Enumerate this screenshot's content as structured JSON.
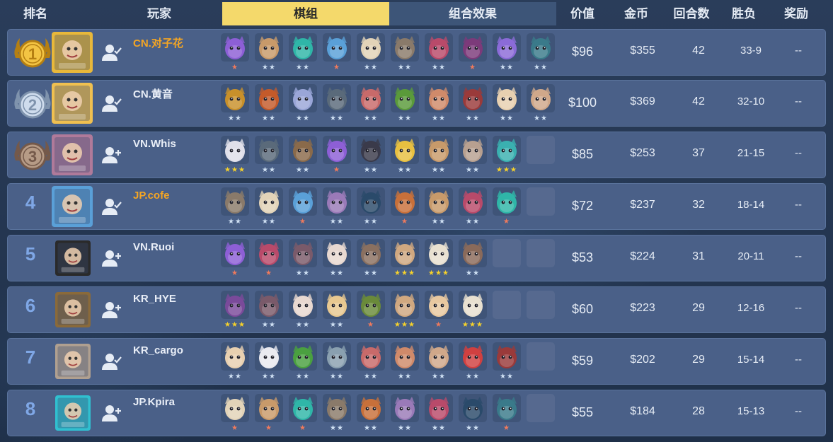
{
  "header": {
    "rank": "排名",
    "player": "玩家",
    "tab_pieces": "棋组",
    "tab_combo": "组合效果",
    "value": "价值",
    "gold": "金币",
    "rounds": "回合数",
    "winloss": "胜负",
    "reward": "奖励"
  },
  "colors": {
    "row_bg": "#4a6088",
    "tab_active": "#f4d96b",
    "highlight_name": "#f5a623",
    "star_bronze": "#f07a5c",
    "star_silver": "#cfe0f3",
    "star_gold": "#f7d22a"
  },
  "rows": [
    {
      "rank": "1",
      "medal": "gold",
      "name": "CN.对子花",
      "highlight": true,
      "friend_icon": "friend-added-icon",
      "value": "$96",
      "gold": "$355",
      "rounds": "42",
      "wl": "33-9",
      "reward": "--",
      "pieces": [
        {
          "c": "#8d5fd6",
          "s": "★"
        },
        {
          "c": "#c89a6a",
          "s": "★★"
        },
        {
          "c": "#2fb6a8",
          "s": "★★"
        },
        {
          "c": "#5aa0d8",
          "s": "★"
        },
        {
          "c": "#e2d3b8",
          "s": "★★"
        },
        {
          "c": "#8a7a6a",
          "s": "★★"
        },
        {
          "c": "#b94a6a",
          "s": "★★"
        },
        {
          "c": "#7c3a7a",
          "s": "★"
        },
        {
          "c": "#8b6bd8",
          "s": "★★"
        },
        {
          "c": "#3a7a8a",
          "s": "★★"
        }
      ]
    },
    {
      "rank": "2",
      "medal": "silver",
      "name": "CN.黄音",
      "highlight": false,
      "friend_icon": "friend-added-icon",
      "value": "$100",
      "gold": "$369",
      "rounds": "42",
      "wl": "32-10",
      "reward": "--",
      "pieces": [
        {
          "c": "#c8902a",
          "s": "★★"
        },
        {
          "c": "#c45a2a",
          "s": "★★"
        },
        {
          "c": "#9aa6d8",
          "s": "★★"
        },
        {
          "c": "#5a6a7a",
          "s": "★★"
        },
        {
          "c": "#c86a6a",
          "s": "★★"
        },
        {
          "c": "#5a9a3a",
          "s": "★★"
        },
        {
          "c": "#d08a6a",
          "s": "★★"
        },
        {
          "c": "#9a3a3a",
          "s": "★★"
        },
        {
          "c": "#e8d0b0",
          "s": "★★"
        },
        {
          "c": "#d0a88a",
          "s": "★★"
        }
      ]
    },
    {
      "rank": "3",
      "medal": "bronze",
      "name": "VN.Whis",
      "highlight": false,
      "friend_icon": "friend-add-icon",
      "value": "$85",
      "gold": "$253",
      "rounds": "37",
      "wl": "21-15",
      "reward": "--",
      "pieces": [
        {
          "c": "#e0e0ea",
          "s": "★★★"
        },
        {
          "c": "#5a6a7a",
          "s": "★★"
        },
        {
          "c": "#8a6a4a",
          "s": "★★"
        },
        {
          "c": "#8d5fd6",
          "s": "★"
        },
        {
          "c": "#3a3a4a",
          "s": "★★"
        },
        {
          "c": "#e8c040",
          "s": "★★"
        },
        {
          "c": "#c89a6a",
          "s": "★★"
        },
        {
          "c": "#b8a090",
          "s": "★★"
        },
        {
          "c": "#3ab0b0",
          "s": "★★★"
        },
        {
          "c": "",
          "s": ""
        }
      ]
    },
    {
      "rank": "4",
      "medal": "",
      "name": "JP.cofe",
      "highlight": true,
      "friend_icon": "friend-added-icon",
      "value": "$72",
      "gold": "$237",
      "rounds": "32",
      "wl": "18-14",
      "reward": "--",
      "pieces": [
        {
          "c": "#8a7a6a",
          "s": "★★"
        },
        {
          "c": "#e2d3b8",
          "s": "★★"
        },
        {
          "c": "#5aa0d8",
          "s": "★"
        },
        {
          "c": "#9a7ab8",
          "s": "★★"
        },
        {
          "c": "#2a4a6a",
          "s": "★★"
        },
        {
          "c": "#c8703a",
          "s": "★"
        },
        {
          "c": "#c89a6a",
          "s": "★★"
        },
        {
          "c": "#b94a6a",
          "s": "★★"
        },
        {
          "c": "#2fb6a8",
          "s": "★"
        },
        {
          "c": "",
          "s": ""
        }
      ]
    },
    {
      "rank": "5",
      "medal": "",
      "name": "VN.Ruoi",
      "highlight": false,
      "friend_icon": "friend-add-icon",
      "value": "$53",
      "gold": "$224",
      "rounds": "31",
      "wl": "20-11",
      "reward": "--",
      "pieces": [
        {
          "c": "#8d5fd6",
          "s": "★"
        },
        {
          "c": "#b94a6a",
          "s": "★"
        },
        {
          "c": "#7a5a6a",
          "s": "★★"
        },
        {
          "c": "#e8d8d0",
          "s": "★★"
        },
        {
          "c": "#8a7060",
          "s": "★★"
        },
        {
          "c": "#d0a880",
          "s": "★★★"
        },
        {
          "c": "#e8e0d0",
          "s": "★★★"
        },
        {
          "c": "#8a6a5a",
          "s": "★★"
        },
        {
          "c": "",
          "s": ""
        },
        {
          "c": "",
          "s": ""
        }
      ]
    },
    {
      "rank": "6",
      "medal": "",
      "name": "KR_HYE",
      "highlight": false,
      "friend_icon": "friend-add-icon",
      "value": "$60",
      "gold": "$223",
      "rounds": "29",
      "wl": "12-16",
      "reward": "--",
      "pieces": [
        {
          "c": "#7a4a9a",
          "s": "★★★"
        },
        {
          "c": "#7a5a6a",
          "s": "★★"
        },
        {
          "c": "#e8d8d0",
          "s": "★★"
        },
        {
          "c": "#e8c890",
          "s": "★★"
        },
        {
          "c": "#6a8a3a",
          "s": "★"
        },
        {
          "c": "#d0a880",
          "s": "★★★"
        },
        {
          "c": "#e8c8a0",
          "s": "★"
        },
        {
          "c": "#e8e0d0",
          "s": "★★★"
        },
        {
          "c": "",
          "s": ""
        },
        {
          "c": "",
          "s": ""
        }
      ]
    },
    {
      "rank": "7",
      "medal": "",
      "name": "KR_cargo",
      "highlight": false,
      "friend_icon": "friend-added-icon",
      "value": "$59",
      "gold": "$202",
      "rounds": "29",
      "wl": "15-14",
      "reward": "--",
      "pieces": [
        {
          "c": "#e8d0b0",
          "s": "★★"
        },
        {
          "c": "#eaeaf0",
          "s": "★★"
        },
        {
          "c": "#4aa040",
          "s": "★★"
        },
        {
          "c": "#8aa0b0",
          "s": "★★"
        },
        {
          "c": "#c86a6a",
          "s": "★★"
        },
        {
          "c": "#d08a6a",
          "s": "★★"
        },
        {
          "c": "#d0a88a",
          "s": "★★"
        },
        {
          "c": "#d04040",
          "s": "★★"
        },
        {
          "c": "#9a3a3a",
          "s": "★★"
        },
        {
          "c": "",
          "s": ""
        }
      ]
    },
    {
      "rank": "8",
      "medal": "",
      "name": "JP.Kpira",
      "highlight": false,
      "friend_icon": "friend-add-icon",
      "value": "$55",
      "gold": "$184",
      "rounds": "28",
      "wl": "15-13",
      "reward": "--",
      "pieces": [
        {
          "c": "#e2d3b8",
          "s": "★"
        },
        {
          "c": "#c89a6a",
          "s": "★"
        },
        {
          "c": "#2fb6a8",
          "s": "★"
        },
        {
          "c": "#8a7a6a",
          "s": "★★"
        },
        {
          "c": "#c8703a",
          "s": "★★"
        },
        {
          "c": "#9a7ab8",
          "s": "★★"
        },
        {
          "c": "#b94a6a",
          "s": "★★"
        },
        {
          "c": "#2a4a6a",
          "s": "★★"
        },
        {
          "c": "#3a7a8a",
          "s": "★"
        },
        {
          "c": "",
          "s": ""
        }
      ]
    }
  ]
}
